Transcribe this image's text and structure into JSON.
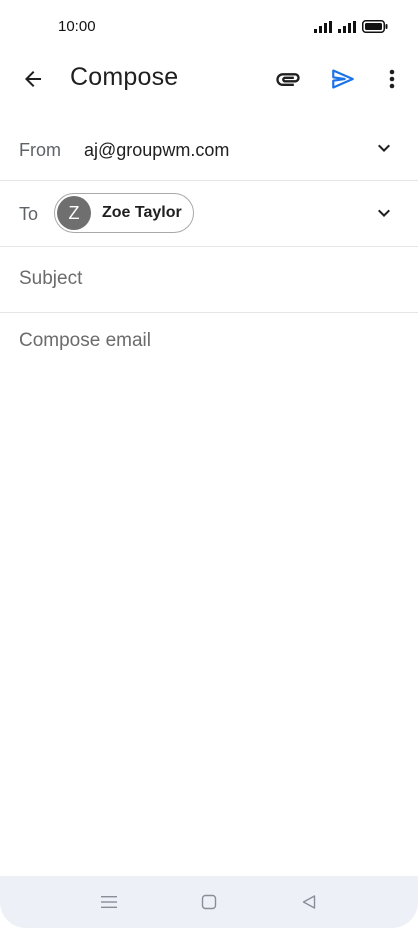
{
  "status_bar": {
    "time": "10:00",
    "icons": [
      "signal-icon",
      "signal-icon",
      "battery-icon"
    ]
  },
  "app_bar": {
    "title": "Compose",
    "icons": [
      "back-arrow-icon",
      "paperclip-icon",
      "send-icon",
      "more-vert-icon"
    ]
  },
  "colors": {
    "accent": "#1a73e8",
    "avatar": "#6f6f6f",
    "nav_bar": "#eef0f7"
  },
  "from": {
    "label": "From",
    "value": "aj@groupwm.com"
  },
  "to": {
    "label": "To",
    "recipient": {
      "initial": "Z",
      "name": "Zoe Taylor"
    }
  },
  "subject": {
    "placeholder": "Subject",
    "value": ""
  },
  "body": {
    "placeholder": "Compose email",
    "value": ""
  },
  "nav_bar": {
    "icons": [
      "menu-icon",
      "home-square-icon",
      "back-triangle-icon"
    ]
  }
}
